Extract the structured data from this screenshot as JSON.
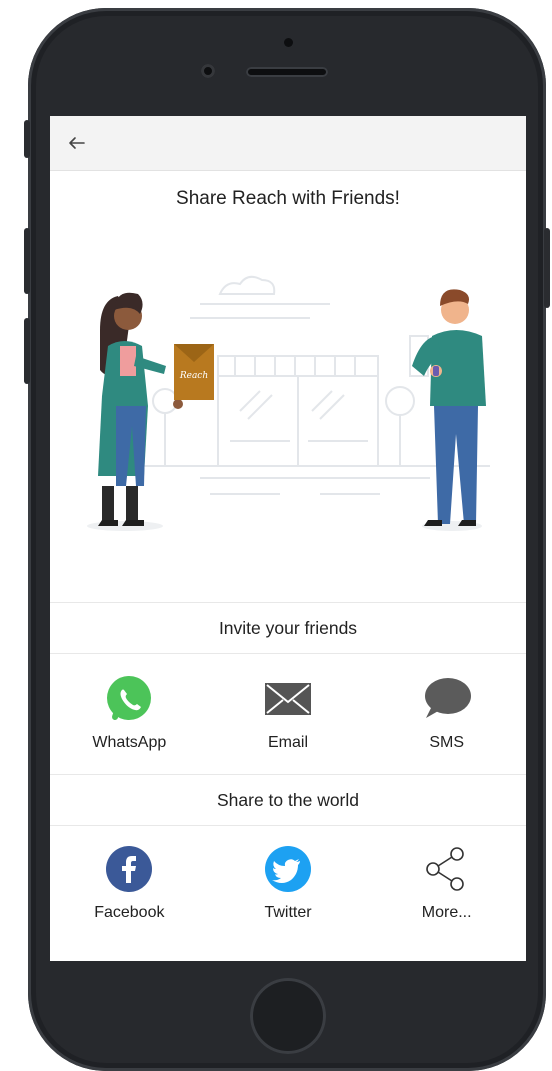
{
  "screen": {
    "title": "Share Reach with Friends!",
    "illustration": {
      "envelope_text": "Reach"
    },
    "invite_section": {
      "label": "Invite your friends",
      "options": [
        {
          "label": "WhatsApp",
          "icon": "whatsapp-icon",
          "color": "#4cc459"
        },
        {
          "label": "Email",
          "icon": "envelope-icon",
          "color": "#555555"
        },
        {
          "label": "SMS",
          "icon": "chat-bubble-icon",
          "color": "#5b5b5b"
        }
      ]
    },
    "world_section": {
      "label": "Share to the world",
      "options": [
        {
          "label": "Facebook",
          "icon": "facebook-icon",
          "color": "#3b5998"
        },
        {
          "label": "Twitter",
          "icon": "twitter-icon",
          "color": "#1da1f2"
        },
        {
          "label": "More...",
          "icon": "share-icon",
          "color": "#333333"
        }
      ]
    }
  },
  "colors": {
    "appbar_bg": "#f3f3f3",
    "phone_frame": "#1f2125"
  }
}
